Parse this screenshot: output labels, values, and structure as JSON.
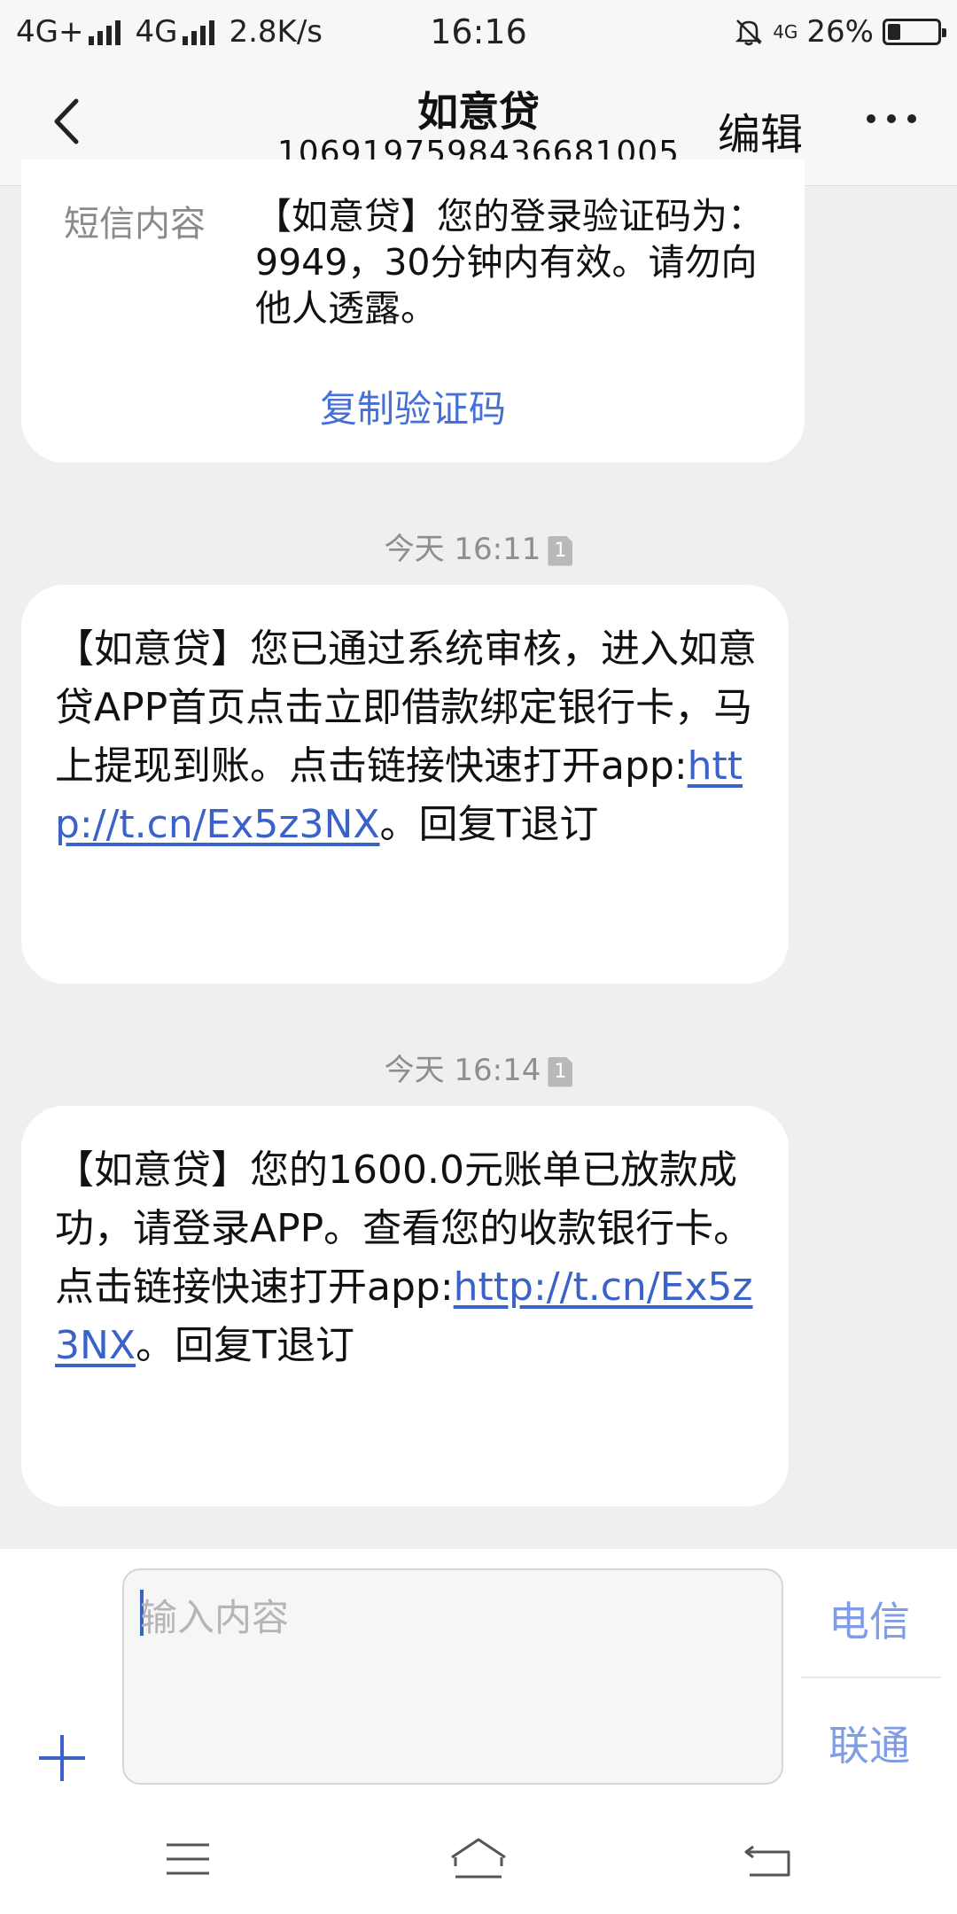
{
  "status_bar": {
    "network1": "4G+",
    "network2": "4G",
    "speed": "2.8K/s",
    "time": "16:16",
    "small_network": "4G",
    "battery": "26%",
    "battery_level": 0.26
  },
  "header": {
    "title": "如意贷",
    "number": "106919759843668​1005",
    "edit_label": "编辑"
  },
  "first_message": {
    "label": "短信内容",
    "content": "【如意贷】您的登录验证码为：9949，30分钟内有效。请勿向他人透露。",
    "copy_label": "复制验证码"
  },
  "messages": [
    {
      "timestamp": "今天 16:11",
      "sim": "1",
      "text_before": "【如意贷】您已通过系统审核，进入如意贷APP首页点击立即借款绑定银行卡，马上提现到账。点击链接快速打开app:",
      "link": "http://t.cn/Ex5z3NX",
      "text_after": "。回复T退订"
    },
    {
      "timestamp": "今天 16:14",
      "sim": "1",
      "text_before": "【如意贷】您的1600.0元账单已放款成功，请登录APP。查看您的收款银行卡。点击链接快速打开app:",
      "link": "http://t.cn/Ex5z3NX",
      "text_after": "。回复T退订"
    }
  ],
  "composer": {
    "placeholder": "输入内容",
    "carrier1": "电信",
    "carrier2": "联通"
  },
  "icons": {
    "back": "chevron-left-icon",
    "more": "more-dots-icon",
    "plus": "plus-icon",
    "menu": "menu-icon",
    "home": "home-icon",
    "nav_back": "back-icon",
    "mute": "bell-off-icon"
  },
  "colors": {
    "link": "#3a62c8",
    "accent": "#4470d8",
    "carrier": "#7f9ce6",
    "background": "#efefef"
  }
}
